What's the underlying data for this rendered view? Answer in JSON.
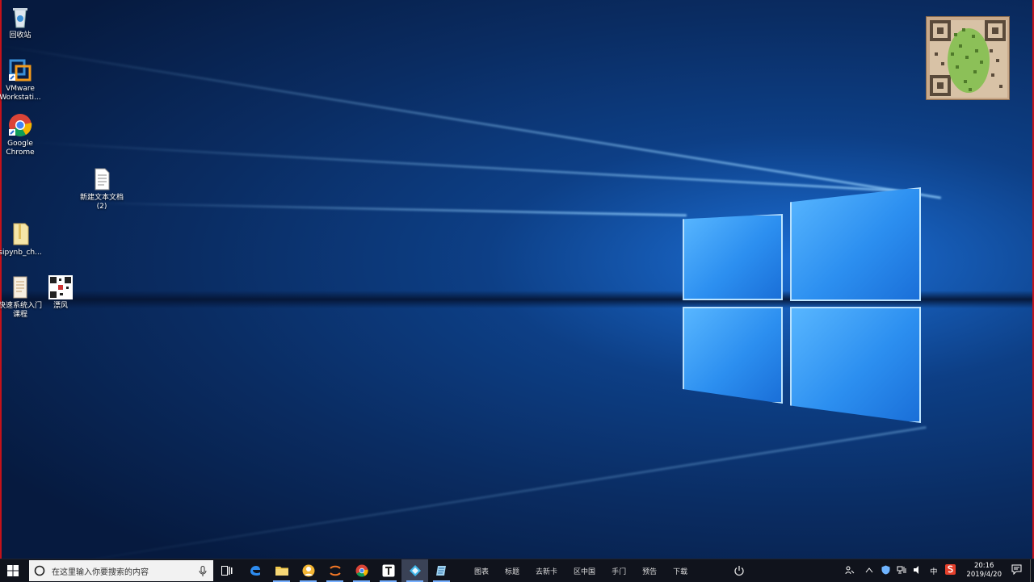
{
  "desktop": {
    "icons": [
      {
        "name": "recycle-bin",
        "label": "回收站"
      },
      {
        "name": "vmware",
        "label": "VMware Workstati..."
      },
      {
        "name": "chrome",
        "label": "Google Chrome"
      },
      {
        "name": "new-text-doc",
        "label": "新建文本文档 (2)"
      },
      {
        "name": "sipynb-folder",
        "label": "sipynb_ch..."
      },
      {
        "name": "quick-system",
        "label": "快速系统入门 课程"
      },
      {
        "name": "qr-file",
        "label": "漂风"
      }
    ]
  },
  "taskbar": {
    "search_placeholder": "在这里输入你要搜索的内容",
    "toolbar_items": [
      "图表",
      "标题",
      "去新卡",
      "区中国",
      "手门",
      "预告",
      "下载"
    ],
    "clock_time": "20:16",
    "clock_date": "2019/4/20",
    "ime_label": "中",
    "colors": {
      "accent": "#77b0ff",
      "taskbar_bg": "#10131c",
      "search_bg": "#f2f2f2"
    }
  }
}
